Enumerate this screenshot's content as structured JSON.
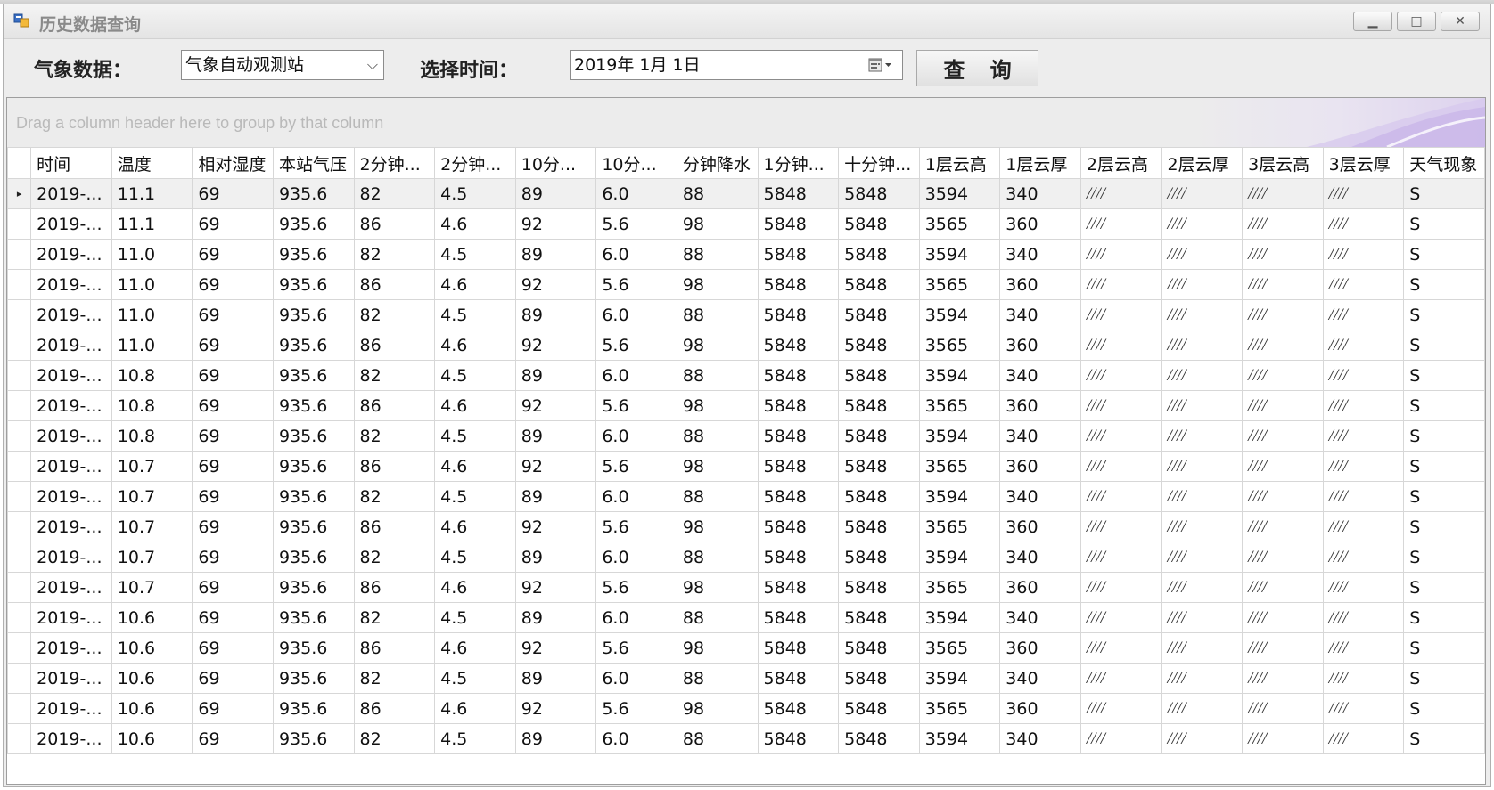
{
  "window": {
    "title": "历史数据查询",
    "controls": {
      "minimize": "▁",
      "maximize": "□",
      "close": "✕"
    }
  },
  "toolbar": {
    "data_label": "气象数据：",
    "data_select_value": "气象自动观测站",
    "time_label": "选择时间：",
    "date_value": "2019年  1月  1日",
    "query_button": "查 询"
  },
  "grid": {
    "group_hint": "Drag a column header here to group by that column",
    "columns": [
      "时间",
      "温度",
      "相对湿度",
      "本站气压",
      "2分钟...",
      "2分钟...",
      "10分...",
      "10分...",
      "分钟降水",
      "1分钟...",
      "十分钟...",
      "1层云高",
      "1层云厚",
      "2层云高",
      "2层云厚",
      "3层云高",
      "3层云厚",
      "天气现象"
    ],
    "rows": [
      [
        "2019-...",
        "11.1",
        "69",
        "935.6",
        "82",
        "4.5",
        "89",
        "6.0",
        "88",
        "5848",
        "5848",
        "3594",
        "340",
        "////",
        "////",
        "////",
        "////",
        "S"
      ],
      [
        "2019-...",
        "11.1",
        "69",
        "935.6",
        "86",
        "4.6",
        "92",
        "5.6",
        "98",
        "5848",
        "5848",
        "3565",
        "360",
        "////",
        "////",
        "////",
        "////",
        "S"
      ],
      [
        "2019-...",
        "11.0",
        "69",
        "935.6",
        "82",
        "4.5",
        "89",
        "6.0",
        "88",
        "5848",
        "5848",
        "3594",
        "340",
        "////",
        "////",
        "////",
        "////",
        "S"
      ],
      [
        "2019-...",
        "11.0",
        "69",
        "935.6",
        "86",
        "4.6",
        "92",
        "5.6",
        "98",
        "5848",
        "5848",
        "3565",
        "360",
        "////",
        "////",
        "////",
        "////",
        "S"
      ],
      [
        "2019-...",
        "11.0",
        "69",
        "935.6",
        "82",
        "4.5",
        "89",
        "6.0",
        "88",
        "5848",
        "5848",
        "3594",
        "340",
        "////",
        "////",
        "////",
        "////",
        "S"
      ],
      [
        "2019-...",
        "11.0",
        "69",
        "935.6",
        "86",
        "4.6",
        "92",
        "5.6",
        "98",
        "5848",
        "5848",
        "3565",
        "360",
        "////",
        "////",
        "////",
        "////",
        "S"
      ],
      [
        "2019-...",
        "10.8",
        "69",
        "935.6",
        "82",
        "4.5",
        "89",
        "6.0",
        "88",
        "5848",
        "5848",
        "3594",
        "340",
        "////",
        "////",
        "////",
        "////",
        "S"
      ],
      [
        "2019-...",
        "10.8",
        "69",
        "935.6",
        "86",
        "4.6",
        "92",
        "5.6",
        "98",
        "5848",
        "5848",
        "3565",
        "360",
        "////",
        "////",
        "////",
        "////",
        "S"
      ],
      [
        "2019-...",
        "10.8",
        "69",
        "935.6",
        "82",
        "4.5",
        "89",
        "6.0",
        "88",
        "5848",
        "5848",
        "3594",
        "340",
        "////",
        "////",
        "////",
        "////",
        "S"
      ],
      [
        "2019-...",
        "10.7",
        "69",
        "935.6",
        "86",
        "4.6",
        "92",
        "5.6",
        "98",
        "5848",
        "5848",
        "3565",
        "360",
        "////",
        "////",
        "////",
        "////",
        "S"
      ],
      [
        "2019-...",
        "10.7",
        "69",
        "935.6",
        "82",
        "4.5",
        "89",
        "6.0",
        "88",
        "5848",
        "5848",
        "3594",
        "340",
        "////",
        "////",
        "////",
        "////",
        "S"
      ],
      [
        "2019-...",
        "10.7",
        "69",
        "935.6",
        "86",
        "4.6",
        "92",
        "5.6",
        "98",
        "5848",
        "5848",
        "3565",
        "360",
        "////",
        "////",
        "////",
        "////",
        "S"
      ],
      [
        "2019-...",
        "10.7",
        "69",
        "935.6",
        "82",
        "4.5",
        "89",
        "6.0",
        "88",
        "5848",
        "5848",
        "3594",
        "340",
        "////",
        "////",
        "////",
        "////",
        "S"
      ],
      [
        "2019-...",
        "10.7",
        "69",
        "935.6",
        "86",
        "4.6",
        "92",
        "5.6",
        "98",
        "5848",
        "5848",
        "3565",
        "360",
        "////",
        "////",
        "////",
        "////",
        "S"
      ],
      [
        "2019-...",
        "10.6",
        "69",
        "935.6",
        "82",
        "4.5",
        "89",
        "6.0",
        "88",
        "5848",
        "5848",
        "3594",
        "340",
        "////",
        "////",
        "////",
        "////",
        "S"
      ],
      [
        "2019-...",
        "10.6",
        "69",
        "935.6",
        "86",
        "4.6",
        "92",
        "5.6",
        "98",
        "5848",
        "5848",
        "3565",
        "360",
        "////",
        "////",
        "////",
        "////",
        "S"
      ],
      [
        "2019-...",
        "10.6",
        "69",
        "935.6",
        "82",
        "4.5",
        "89",
        "6.0",
        "88",
        "5848",
        "5848",
        "3594",
        "340",
        "////",
        "////",
        "////",
        "////",
        "S"
      ],
      [
        "2019-...",
        "10.6",
        "69",
        "935.6",
        "86",
        "4.6",
        "92",
        "5.6",
        "98",
        "5848",
        "5848",
        "3565",
        "360",
        "////",
        "////",
        "////",
        "////",
        "S"
      ],
      [
        "2019-...",
        "10.6",
        "69",
        "935.6",
        "82",
        "4.5",
        "89",
        "6.0",
        "88",
        "5848",
        "5848",
        "3594",
        "340",
        "////",
        "////",
        "////",
        "////",
        "S"
      ]
    ],
    "selected_row": 0,
    "row_indicator": "▸"
  },
  "icons": {
    "app": "app-window-icon",
    "dropdown": "chevron-down-icon",
    "calendar": "calendar-icon"
  },
  "colors": {
    "window_bg": "#ededed",
    "grid_border": "#d7d7d7",
    "group_hint": "#b9b9b9"
  }
}
